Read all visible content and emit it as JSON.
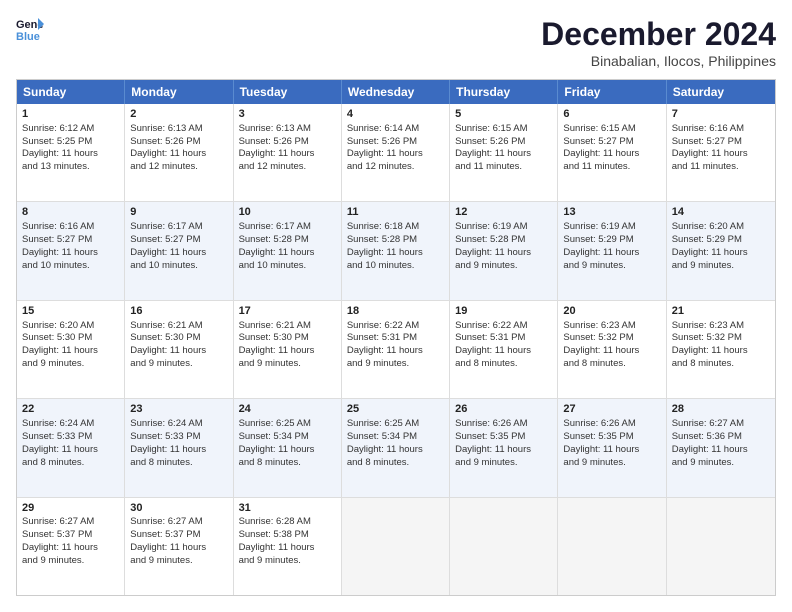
{
  "logo": {
    "line1": "General",
    "line2": "Blue"
  },
  "title": "December 2024",
  "subtitle": "Binabalian, Ilocos, Philippines",
  "weekdays": [
    "Sunday",
    "Monday",
    "Tuesday",
    "Wednesday",
    "Thursday",
    "Friday",
    "Saturday"
  ],
  "weeks": [
    {
      "alt": false,
      "days": [
        {
          "num": "1",
          "lines": [
            "Sunrise: 6:12 AM",
            "Sunset: 5:25 PM",
            "Daylight: 11 hours",
            "and 13 minutes."
          ]
        },
        {
          "num": "2",
          "lines": [
            "Sunrise: 6:13 AM",
            "Sunset: 5:26 PM",
            "Daylight: 11 hours",
            "and 12 minutes."
          ]
        },
        {
          "num": "3",
          "lines": [
            "Sunrise: 6:13 AM",
            "Sunset: 5:26 PM",
            "Daylight: 11 hours",
            "and 12 minutes."
          ]
        },
        {
          "num": "4",
          "lines": [
            "Sunrise: 6:14 AM",
            "Sunset: 5:26 PM",
            "Daylight: 11 hours",
            "and 12 minutes."
          ]
        },
        {
          "num": "5",
          "lines": [
            "Sunrise: 6:15 AM",
            "Sunset: 5:26 PM",
            "Daylight: 11 hours",
            "and 11 minutes."
          ]
        },
        {
          "num": "6",
          "lines": [
            "Sunrise: 6:15 AM",
            "Sunset: 5:27 PM",
            "Daylight: 11 hours",
            "and 11 minutes."
          ]
        },
        {
          "num": "7",
          "lines": [
            "Sunrise: 6:16 AM",
            "Sunset: 5:27 PM",
            "Daylight: 11 hours",
            "and 11 minutes."
          ]
        }
      ]
    },
    {
      "alt": true,
      "days": [
        {
          "num": "8",
          "lines": [
            "Sunrise: 6:16 AM",
            "Sunset: 5:27 PM",
            "Daylight: 11 hours",
            "and 10 minutes."
          ]
        },
        {
          "num": "9",
          "lines": [
            "Sunrise: 6:17 AM",
            "Sunset: 5:27 PM",
            "Daylight: 11 hours",
            "and 10 minutes."
          ]
        },
        {
          "num": "10",
          "lines": [
            "Sunrise: 6:17 AM",
            "Sunset: 5:28 PM",
            "Daylight: 11 hours",
            "and 10 minutes."
          ]
        },
        {
          "num": "11",
          "lines": [
            "Sunrise: 6:18 AM",
            "Sunset: 5:28 PM",
            "Daylight: 11 hours",
            "and 10 minutes."
          ]
        },
        {
          "num": "12",
          "lines": [
            "Sunrise: 6:19 AM",
            "Sunset: 5:28 PM",
            "Daylight: 11 hours",
            "and 9 minutes."
          ]
        },
        {
          "num": "13",
          "lines": [
            "Sunrise: 6:19 AM",
            "Sunset: 5:29 PM",
            "Daylight: 11 hours",
            "and 9 minutes."
          ]
        },
        {
          "num": "14",
          "lines": [
            "Sunrise: 6:20 AM",
            "Sunset: 5:29 PM",
            "Daylight: 11 hours",
            "and 9 minutes."
          ]
        }
      ]
    },
    {
      "alt": false,
      "days": [
        {
          "num": "15",
          "lines": [
            "Sunrise: 6:20 AM",
            "Sunset: 5:30 PM",
            "Daylight: 11 hours",
            "and 9 minutes."
          ]
        },
        {
          "num": "16",
          "lines": [
            "Sunrise: 6:21 AM",
            "Sunset: 5:30 PM",
            "Daylight: 11 hours",
            "and 9 minutes."
          ]
        },
        {
          "num": "17",
          "lines": [
            "Sunrise: 6:21 AM",
            "Sunset: 5:30 PM",
            "Daylight: 11 hours",
            "and 9 minutes."
          ]
        },
        {
          "num": "18",
          "lines": [
            "Sunrise: 6:22 AM",
            "Sunset: 5:31 PM",
            "Daylight: 11 hours",
            "and 9 minutes."
          ]
        },
        {
          "num": "19",
          "lines": [
            "Sunrise: 6:22 AM",
            "Sunset: 5:31 PM",
            "Daylight: 11 hours",
            "and 8 minutes."
          ]
        },
        {
          "num": "20",
          "lines": [
            "Sunrise: 6:23 AM",
            "Sunset: 5:32 PM",
            "Daylight: 11 hours",
            "and 8 minutes."
          ]
        },
        {
          "num": "21",
          "lines": [
            "Sunrise: 6:23 AM",
            "Sunset: 5:32 PM",
            "Daylight: 11 hours",
            "and 8 minutes."
          ]
        }
      ]
    },
    {
      "alt": true,
      "days": [
        {
          "num": "22",
          "lines": [
            "Sunrise: 6:24 AM",
            "Sunset: 5:33 PM",
            "Daylight: 11 hours",
            "and 8 minutes."
          ]
        },
        {
          "num": "23",
          "lines": [
            "Sunrise: 6:24 AM",
            "Sunset: 5:33 PM",
            "Daylight: 11 hours",
            "and 8 minutes."
          ]
        },
        {
          "num": "24",
          "lines": [
            "Sunrise: 6:25 AM",
            "Sunset: 5:34 PM",
            "Daylight: 11 hours",
            "and 8 minutes."
          ]
        },
        {
          "num": "25",
          "lines": [
            "Sunrise: 6:25 AM",
            "Sunset: 5:34 PM",
            "Daylight: 11 hours",
            "and 8 minutes."
          ]
        },
        {
          "num": "26",
          "lines": [
            "Sunrise: 6:26 AM",
            "Sunset: 5:35 PM",
            "Daylight: 11 hours",
            "and 9 minutes."
          ]
        },
        {
          "num": "27",
          "lines": [
            "Sunrise: 6:26 AM",
            "Sunset: 5:35 PM",
            "Daylight: 11 hours",
            "and 9 minutes."
          ]
        },
        {
          "num": "28",
          "lines": [
            "Sunrise: 6:27 AM",
            "Sunset: 5:36 PM",
            "Daylight: 11 hours",
            "and 9 minutes."
          ]
        }
      ]
    },
    {
      "alt": false,
      "days": [
        {
          "num": "29",
          "lines": [
            "Sunrise: 6:27 AM",
            "Sunset: 5:37 PM",
            "Daylight: 11 hours",
            "and 9 minutes."
          ]
        },
        {
          "num": "30",
          "lines": [
            "Sunrise: 6:27 AM",
            "Sunset: 5:37 PM",
            "Daylight: 11 hours",
            "and 9 minutes."
          ]
        },
        {
          "num": "31",
          "lines": [
            "Sunrise: 6:28 AM",
            "Sunset: 5:38 PM",
            "Daylight: 11 hours",
            "and 9 minutes."
          ]
        },
        {
          "num": "",
          "lines": []
        },
        {
          "num": "",
          "lines": []
        },
        {
          "num": "",
          "lines": []
        },
        {
          "num": "",
          "lines": []
        }
      ]
    }
  ]
}
